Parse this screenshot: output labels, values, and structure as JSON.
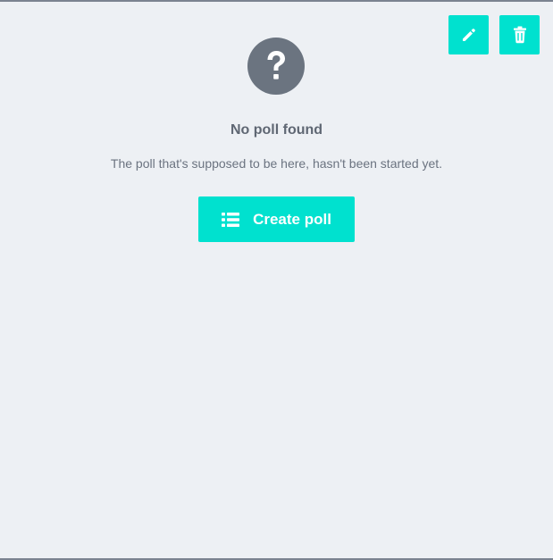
{
  "empty_state": {
    "title": "No poll found",
    "message": "The poll that's supposed to be here, hasn't been started yet.",
    "create_button_label": "Create poll"
  },
  "icons": {
    "edit": "pencil-icon",
    "delete": "trash-icon",
    "status": "question-circle-icon",
    "create": "list-icon"
  },
  "colors": {
    "accent": "#00e1cf",
    "background": "#edf0f4",
    "icon_gray": "#6b7480",
    "text_dark": "#5f6773",
    "text_muted": "#6b7380"
  }
}
